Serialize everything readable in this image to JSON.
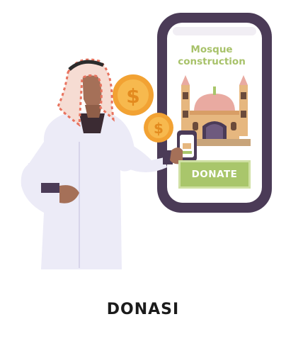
{
  "illustration": {
    "phone": {
      "title": "Mosque construction",
      "button_label": "DONATE"
    },
    "colors": {
      "phone_frame": "#4b3b57",
      "accent_green": "#a9c66b",
      "mosque_dome": "#e9aaa1",
      "mosque_wall": "#e6b77f",
      "coin": "#f2a233",
      "robe": "#ecebf7",
      "keffiyeh_red": "#e8735f"
    },
    "icons": [
      "phone-icon",
      "mosque-icon",
      "coin-icon",
      "man-icon"
    ]
  },
  "caption": "DONASI"
}
